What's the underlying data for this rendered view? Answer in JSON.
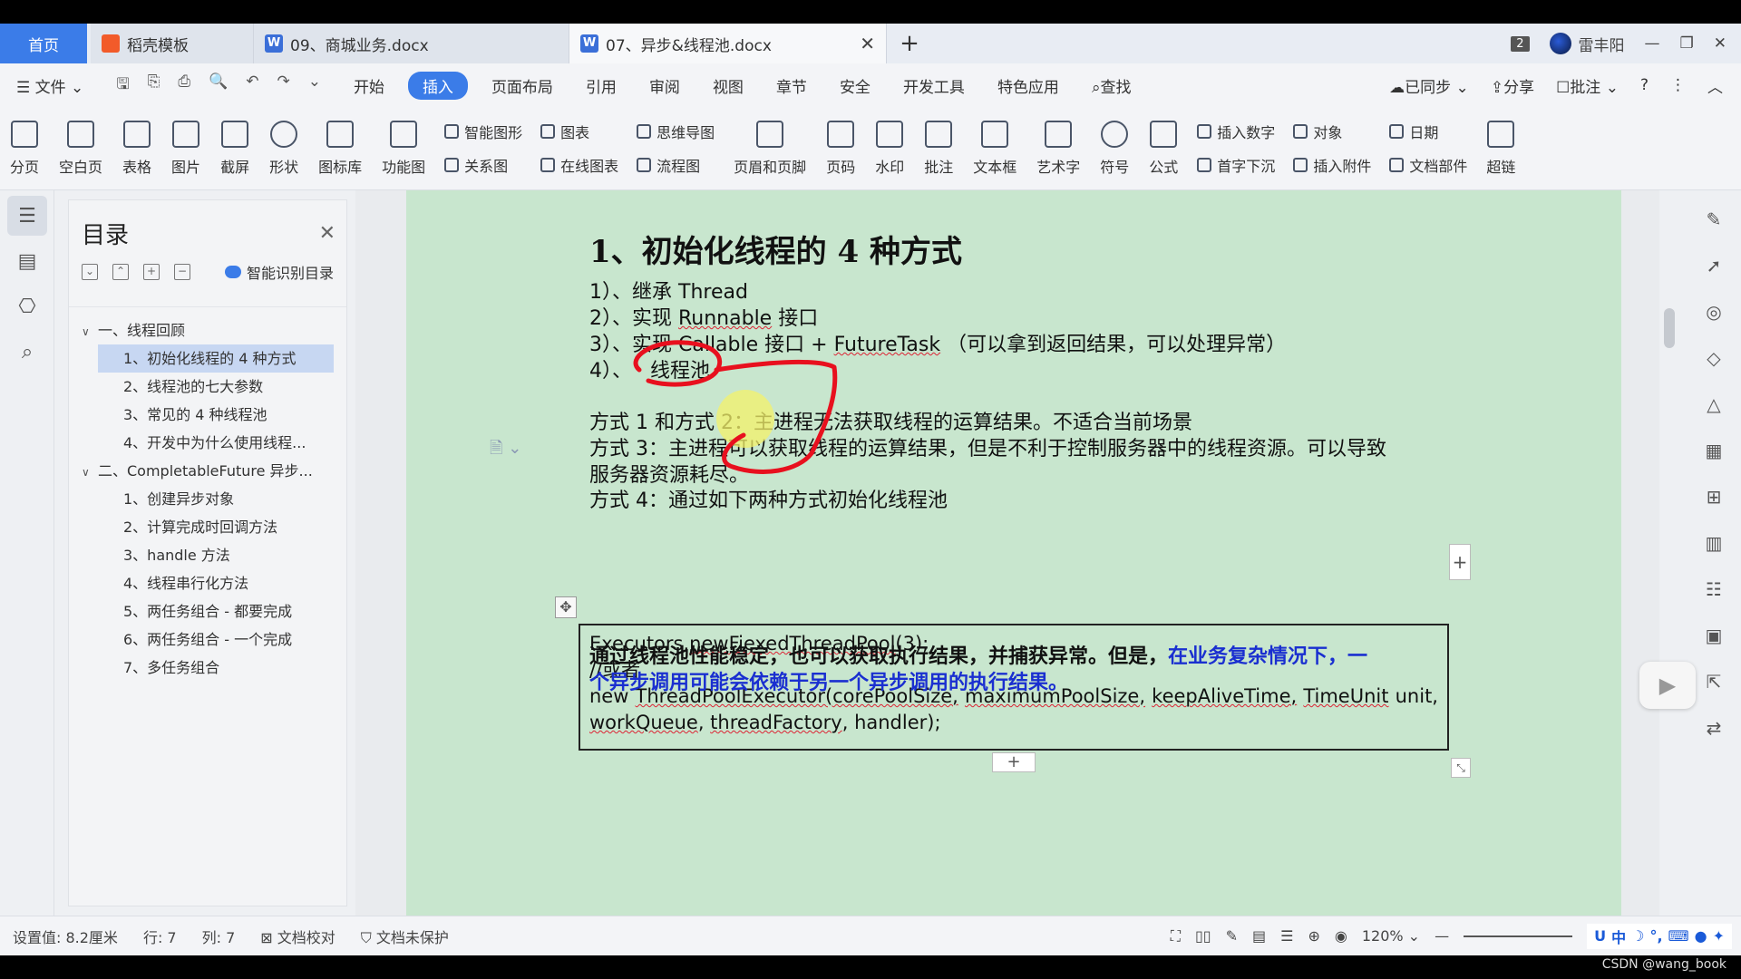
{
  "tabs": {
    "home": "首页",
    "items": [
      {
        "label": "稻壳模板",
        "icon": "docer-icon"
      },
      {
        "label": "09、商城业务.docx",
        "icon": "word-doc-icon"
      },
      {
        "label": "07、异步&线程池.docx",
        "icon": "word-doc-icon",
        "active": true
      }
    ],
    "new_tab": "+",
    "window_count": "2",
    "user_name": "雷丰阳"
  },
  "menu": {
    "file": "文件",
    "items": [
      "开始",
      "插入",
      "页面布局",
      "引用",
      "审阅",
      "视图",
      "章节",
      "安全",
      "开发工具",
      "特色应用"
    ],
    "active": "插入",
    "search": "查找",
    "synced": "已同步",
    "share": "分享",
    "comment": "批注"
  },
  "ribbon": {
    "big_left": [
      "分页",
      "空白页",
      "表格",
      "图片",
      "截屏",
      "形状",
      "图标库",
      "功能图"
    ],
    "small_group1": [
      "智能图形",
      "关系图"
    ],
    "small_group2": [
      "图表",
      "在线图表"
    ],
    "small_group3": [
      "思维导图",
      "流程图"
    ],
    "big_mid": [
      "页眉和页脚",
      "页码",
      "水印",
      "批注",
      "文本框",
      "艺术字",
      "符号",
      "公式"
    ],
    "small_group4": [
      "插入数字",
      "首字下沉"
    ],
    "small_group5": [
      "对象",
      "插入附件"
    ],
    "small_group6": [
      "日期",
      "文档部件"
    ],
    "last": "超链"
  },
  "toc": {
    "title": "目录",
    "smart_label": "智能识别目录",
    "items": [
      {
        "text": "一、线程回顾",
        "level": 1
      },
      {
        "text": "1、初始化线程的 4 种方式",
        "level": 2,
        "selected": true
      },
      {
        "text": "2、线程池的七大参数",
        "level": 2
      },
      {
        "text": "3、常见的 4 种线程池",
        "level": 2
      },
      {
        "text": "4、开发中为什么使用线程...",
        "level": 2
      },
      {
        "text": "二、CompletableFuture 异步...",
        "level": 1
      },
      {
        "text": "1、创建异步对象",
        "level": 2
      },
      {
        "text": "2、计算完成时回调方法",
        "level": 2
      },
      {
        "text": "3、handle 方法",
        "level": 2
      },
      {
        "text": "4、线程串行化方法",
        "level": 2
      },
      {
        "text": "5、两任务组合 - 都要完成",
        "level": 2
      },
      {
        "text": "6、两任务组合 - 一个完成",
        "level": 2
      },
      {
        "text": "7、多任务组合",
        "level": 2
      }
    ]
  },
  "doc": {
    "heading": "1、初始化线程的 4 种方式",
    "list": {
      "l1a": "1）、继承 ",
      "l1b": "Thread",
      "l2a": "2）、实现 ",
      "l2b": "Runnable",
      "l2c": " 接口",
      "l3a": "3）、实现 Callable 接口 + ",
      "l3b": "FutureTask",
      "l3c": " （可以拿到返回结果，可以处理异常）",
      "l4a": "4）、",
      "l4b": "线程池"
    },
    "p1": "方式 1 和方式 2：主进程无法获取线程的运算结果。不适合当前场景",
    "p2": "方式 3：主进程可以获取线程的运算结果，但是不利于控制服务器中的线程资源。可以导致",
    "p3": "服务器资源耗尽。",
    "p4": "方式 4：通过如下两种方式初始化线程池",
    "code": {
      "c1a": "Executors.",
      "c1b": "newFiexedThreadPool",
      "c1c": "(3);",
      "c2": "//或者",
      "c3": [
        "new",
        "ThreadPoolExecutor(corePoolSize,",
        "maximumPoolSize,",
        "keepAliveTime,",
        "TimeUnit",
        "unit,"
      ],
      "c4a": "workQueue",
      "c4b": ", ",
      "c4c": "threadFactory",
      "c4d": ", handler);"
    },
    "concl_bold": "通过线程池性能稳定，也可以获取执行结果，并捕获异常。但是，",
    "concl_blue1": "在业务复杂情况下，一",
    "concl_blue2": "个异步调用可能会依赖于另一个异步调用的执行结果。",
    "annotation_color": "#e8101e"
  },
  "status": {
    "setting": "设置值: 8.2厘米",
    "row": "行: 7",
    "col": "列: 7",
    "proof": "文档校对",
    "protect": "文档未保护",
    "zoom": "120%"
  },
  "ime": "中",
  "watermark": "CSDN @wang_book"
}
